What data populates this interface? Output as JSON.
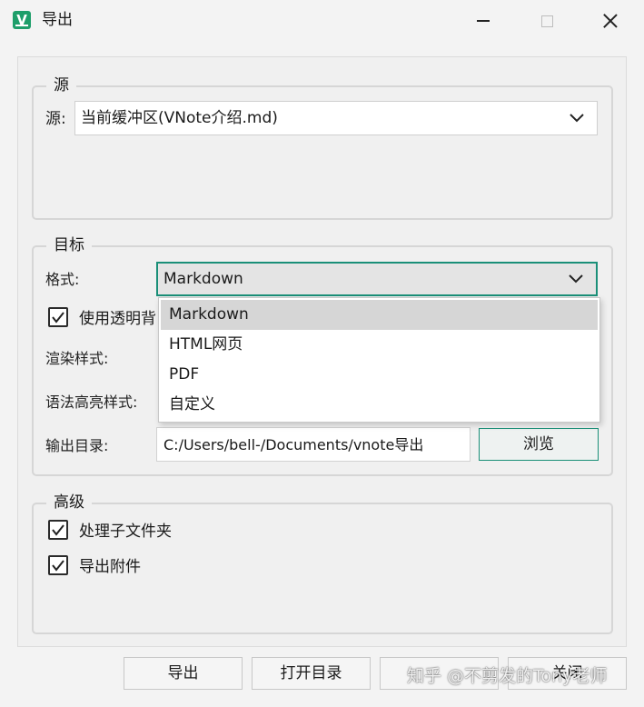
{
  "window": {
    "title": "导出",
    "app_icon_letter": "V"
  },
  "source_group": {
    "title": "源",
    "source_label": "源:",
    "source_value": "当前缓冲区(VNote介绍.md)"
  },
  "target_group": {
    "title": "目标",
    "format_label": "格式:",
    "format_value": "Markdown",
    "format_options": [
      "Markdown",
      "HTML网页",
      "PDF",
      "自定义"
    ],
    "transparent_bg_label": "使用透明背",
    "transparent_bg_checked": true,
    "render_style_label": "渲染样式:",
    "syntax_style_label": "语法高亮样式:",
    "output_dir_label": "输出目录:",
    "output_dir_value": "C:/Users/bell-/Documents/vnote导出",
    "browse_label": "浏览"
  },
  "advanced_group": {
    "title": "高级",
    "process_subfolders_label": "处理子文件夹",
    "process_subfolders_checked": true,
    "export_attachments_label": "导出附件",
    "export_attachments_checked": true
  },
  "footer": {
    "export_label": "导出",
    "open_dir_label": "打开目录",
    "close_label": "关闭",
    "watermark": "知乎 @不剪发的Tony老师"
  },
  "colors": {
    "accent": "#1a8f78",
    "app_icon": "#1e9e6a"
  }
}
